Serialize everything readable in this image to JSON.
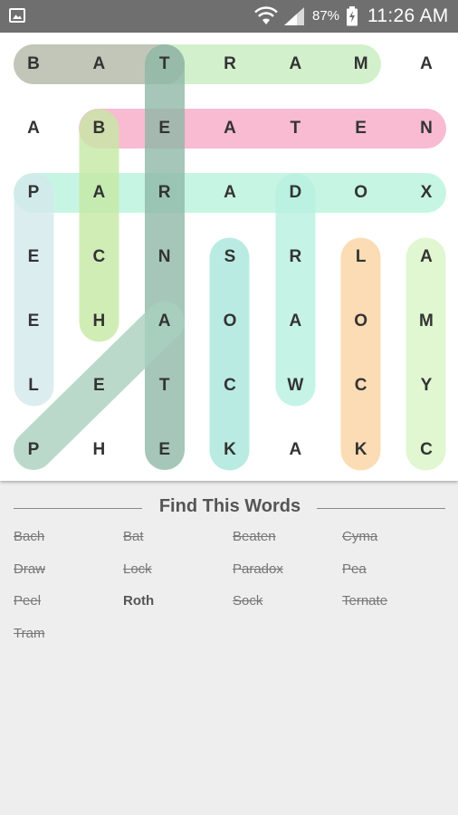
{
  "status_bar": {
    "battery_percent": "87%",
    "time": "11:26 AM",
    "icons": [
      "gallery-icon",
      "wifi-icon",
      "signal-icon",
      "battery-charging-icon"
    ]
  },
  "grid": {
    "rows": [
      [
        "B",
        "A",
        "T",
        "R",
        "A",
        "M",
        "A"
      ],
      [
        "A",
        "B",
        "E",
        "A",
        "T",
        "E",
        "N"
      ],
      [
        "P",
        "A",
        "R",
        "A",
        "D",
        "O",
        "X"
      ],
      [
        "E",
        "C",
        "N",
        "S",
        "R",
        "L",
        "A"
      ],
      [
        "E",
        "H",
        "A",
        "O",
        "A",
        "O",
        "M"
      ],
      [
        "L",
        "E",
        "T",
        "C",
        "W",
        "C",
        "Y"
      ],
      [
        "P",
        "H",
        "E",
        "K",
        "A",
        "K",
        "C"
      ]
    ],
    "highlights": [
      {
        "word": "Tram",
        "color": "#c8ecbf"
      },
      {
        "word": "Bat",
        "color": "#b3b8a8"
      },
      {
        "word": "Beaten",
        "color": "#f6aac6"
      },
      {
        "word": "Paradox",
        "color": "#b9f2dc"
      },
      {
        "word": "Ternate",
        "color": "#8fb8a7"
      },
      {
        "word": "Bach",
        "color": "#c6e8a4"
      },
      {
        "word": "Peel",
        "color": "#d3e8ec"
      },
      {
        "word": "Pea",
        "color": "#a9cfbe"
      },
      {
        "word": "Sock",
        "color": "#a9e6dc"
      },
      {
        "word": "Draw",
        "color": "#b6f0de"
      },
      {
        "word": "Lock",
        "color": "#fbd3a3"
      },
      {
        "word": "Cyma",
        "color": "#d8f5c6"
      }
    ]
  },
  "words_panel": {
    "title": "Find This Words",
    "words": [
      {
        "text": "Bach",
        "state": "found"
      },
      {
        "text": "Bat",
        "state": "found"
      },
      {
        "text": "Beaten",
        "state": "found"
      },
      {
        "text": "Cyma",
        "state": "found"
      },
      {
        "text": "Draw",
        "state": "found"
      },
      {
        "text": "Lock",
        "state": "found"
      },
      {
        "text": "Paradox",
        "state": "found"
      },
      {
        "text": "Pea",
        "state": "found"
      },
      {
        "text": "Peel",
        "state": "found"
      },
      {
        "text": "Roth",
        "state": "remaining"
      },
      {
        "text": "Sock",
        "state": "found"
      },
      {
        "text": "Ternate",
        "state": "found"
      },
      {
        "text": "Tram",
        "state": "found"
      }
    ]
  }
}
